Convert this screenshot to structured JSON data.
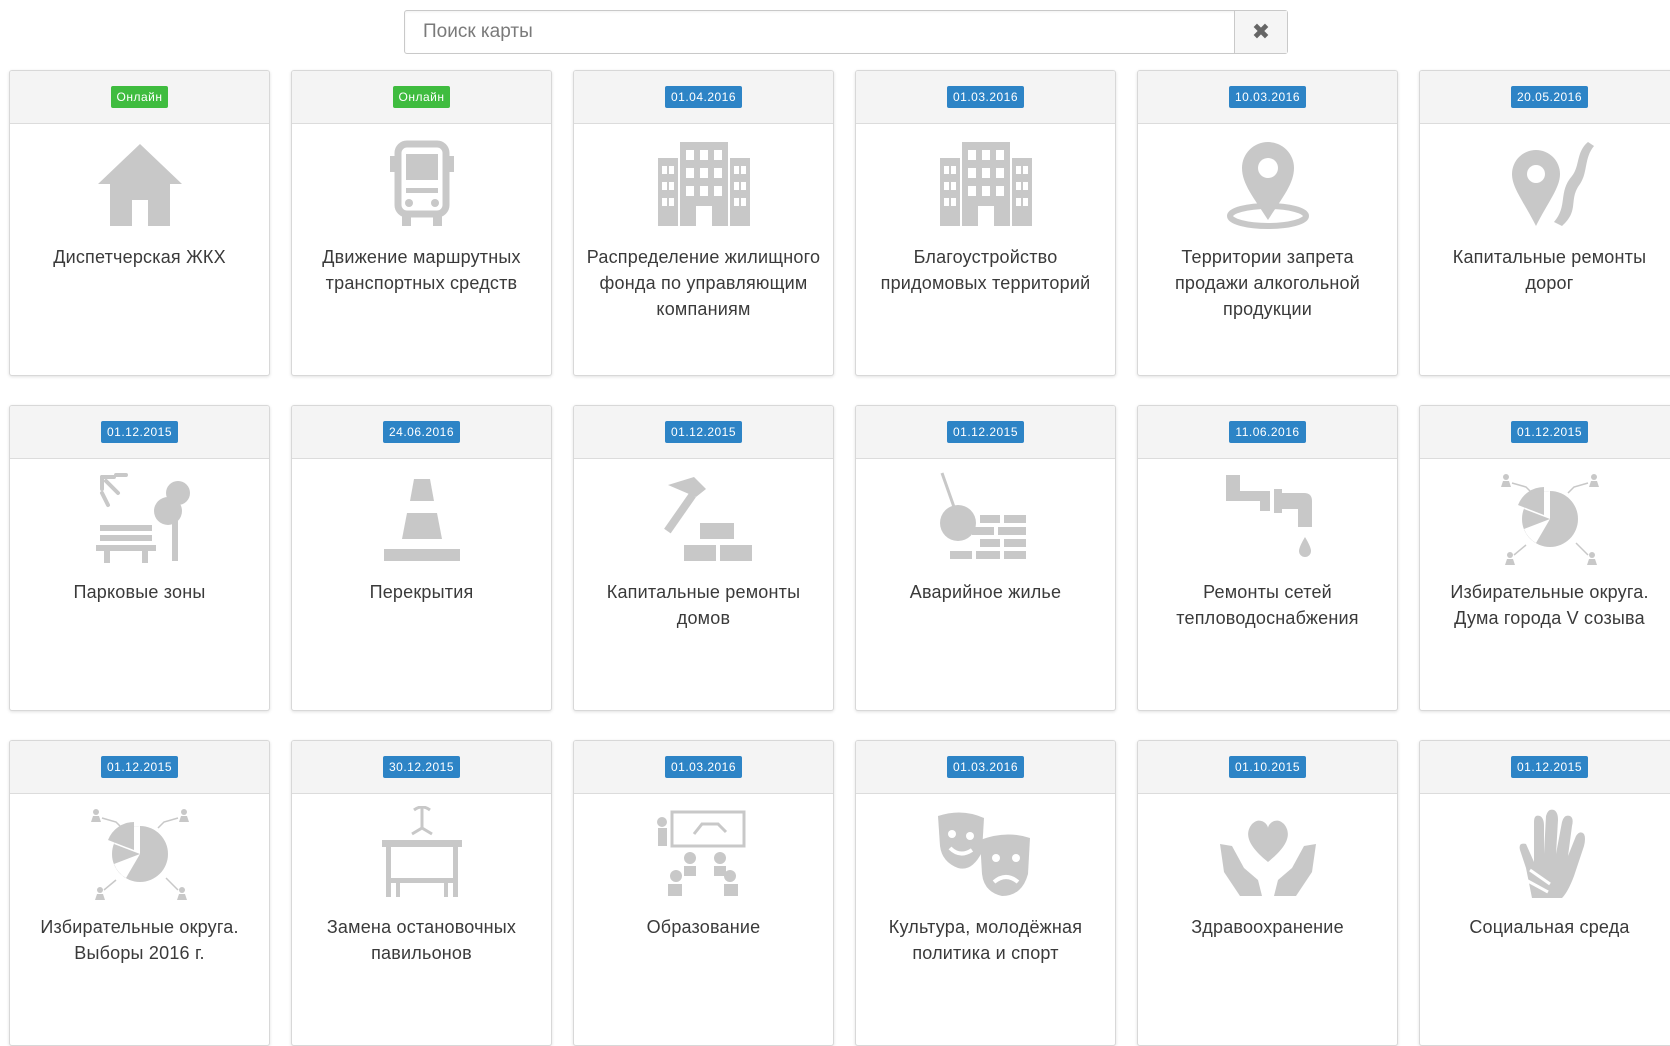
{
  "search": {
    "placeholder": "Поиск карты",
    "value": "",
    "clear_icon": "close-icon"
  },
  "cards": [
    {
      "title": "Диспетчерская ЖКХ",
      "badge": "Онлайн",
      "status": "online",
      "icon": "house-icon"
    },
    {
      "title": "Движение маршрутных транспортных средств",
      "badge": "Онлайн",
      "status": "online",
      "icon": "bus-icon"
    },
    {
      "title": "Распределение жилищного фонда по управляющим компаниям",
      "badge": "01.04.2016",
      "status": "date",
      "icon": "building-icon"
    },
    {
      "title": "Благоустройство придомовых территорий",
      "badge": "01.03.2016",
      "status": "date",
      "icon": "building-icon"
    },
    {
      "title": "Территории запрета продажи алкогольной продукции",
      "badge": "10.03.2016",
      "status": "date",
      "icon": "map-pin-icon"
    },
    {
      "title": "Капитальные ремонты дорог",
      "badge": "20.05.2016",
      "status": "date",
      "icon": "road-pin-icon"
    },
    {
      "title": "Парковые зоны",
      "badge": "01.12.2015",
      "status": "date",
      "icon": "park-bench-icon"
    },
    {
      "title": "Перекрытия",
      "badge": "24.06.2016",
      "status": "date",
      "icon": "traffic-cone-icon"
    },
    {
      "title": "Капитальные ремонты домов",
      "badge": "01.12.2015",
      "status": "date",
      "icon": "hammer-bricks-icon"
    },
    {
      "title": "Аварийное жилье",
      "badge": "01.12.2015",
      "status": "date",
      "icon": "wrecking-ball-icon"
    },
    {
      "title": "Ремонты сетей тепловодоснабжения",
      "badge": "11.06.2016",
      "status": "date",
      "icon": "pipe-faucet-icon"
    },
    {
      "title": "Избирательные округа. Дума города V созыва",
      "badge": "01.12.2015",
      "status": "date",
      "icon": "pie-people-icon"
    },
    {
      "title": "Избирательные округа. Выборы 2016 г.",
      "badge": "01.12.2015",
      "status": "date",
      "icon": "pie-people-icon"
    },
    {
      "title": "Замена остановочных павильонов",
      "badge": "30.12.2015",
      "status": "date",
      "icon": "bus-shelter-icon"
    },
    {
      "title": "Образование",
      "badge": "01.03.2016",
      "status": "date",
      "icon": "classroom-icon"
    },
    {
      "title": "Культура, молодёжная политика и спорт",
      "badge": "01.03.2016",
      "status": "date",
      "icon": "theater-masks-icon"
    },
    {
      "title": "Здравоохранение",
      "badge": "01.10.2015",
      "status": "date",
      "icon": "heart-hands-icon"
    },
    {
      "title": "Социальная среда",
      "badge": "01.12.2015",
      "status": "date",
      "icon": "hand-icon"
    }
  ],
  "colors": {
    "date_badge": "#2d84c6",
    "online_badge": "#3fbc3f",
    "icon": "#c8c8c8",
    "title_text": "#3a3a3a"
  }
}
